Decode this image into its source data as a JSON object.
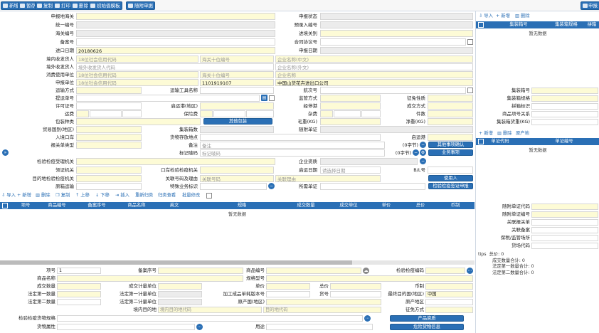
{
  "toolbar": {
    "buttons": [
      "新增",
      "暂存",
      "复制",
      "打印",
      "删除",
      "初始值模板",
      "随附单据"
    ],
    "right_button": "申报"
  },
  "form": {
    "declare_customs": "申报地海关",
    "declare_status": "申报状态",
    "unified_no": "统一编号",
    "preentry_no": "预录入编号",
    "customs_no": "海关编号",
    "entry_exit_customs": "进境关别",
    "record_no": "备案号",
    "contract_no": "合同协议号",
    "import_date": "进口日期",
    "import_date_value": "20180626",
    "declare_date": "申报日期",
    "domestic_consignee": "境内收发货人",
    "credit_code_ph": "18位社会信用代码",
    "customs_ten_ph": "海关十位编号",
    "ent_name_cn_ph": "企业名称(中文)",
    "overseas_consignee": "境外收发货人",
    "overseas_ph": "境外收发货人代码",
    "ent_name_en_ph": "企业名称(外文)",
    "consumer_unit": "消费使用单位",
    "ent_name_ph": "企业名称",
    "declare_unit": "申报单位",
    "declare_code_value": "1101919107",
    "declare_unit_name": "中国山货花卉进出口公司",
    "transport_mode": "运输方式",
    "transport_tool": "运输工具名称",
    "voyage_no": "航次号",
    "bill_no": "提运单号",
    "supervise_mode": "监管方式",
    "tax_nature": "征免性质",
    "license_no": "许可证号",
    "depart_port": "启运港(地区)",
    "bill_unit": "经停港",
    "deal_mode": "成交方式",
    "freight": "运费",
    "insurance": "保险费",
    "misc_fee": "杂费",
    "pieces": "件数",
    "pack_type": "包装种类",
    "other_pack_btn": "其他包装",
    "gross_weight": "毛重(KG)",
    "net_weight": "净重(KG)",
    "trade_country": "贸易国别(地区)",
    "container_no_q": "集装箱数",
    "attach_doc": "随附单证",
    "entry_port": "入境口岸",
    "goods_place": "货物存放地点",
    "depart_port2": "启运港",
    "declare_type": "报关单类型",
    "remark": "备注",
    "remark_ph": "备注",
    "char_count": "(0字节)",
    "other_confirm_btn": "其他事项确认",
    "mark_no": "标记唛码",
    "mark_ph": "标记唛码",
    "char_count2": "(0字节)",
    "business_btn": "业务事项",
    "inspect_org": "检验检疫受理机关",
    "ent_qual": "企业资质",
    "port_org": "领证机关",
    "port_inspect_org": "口岸检验检疫机关",
    "depart_date": "启运日期",
    "depart_date_ph": "请选择日期",
    "bl_no": "B/L号",
    "dest_org": "目的地检验检疫机关",
    "related_no": "关联号码及理由",
    "related_no_ph": "关联号码",
    "related_reason_ph": "关联理由",
    "user_btn": "使用人",
    "orig_transport": "原箱运输",
    "special_biz": "特殊业务标识",
    "attach_doc2": "所需单证",
    "inspect_cert_btn": "检验检疫签证申报"
  },
  "goods_toolbar": {
    "buttons": [
      "导入",
      "新增",
      "删除",
      "复制",
      "上移",
      "下移",
      "插入",
      "重新归类",
      "归类查看",
      "批量修改"
    ]
  },
  "goods_table": {
    "headers": [
      "项号",
      "商品编号",
      "备案序号",
      "商品名称",
      "英文",
      "规格",
      "成交数量",
      "成交单位",
      "单价",
      "总价",
      "币制"
    ],
    "empty": "暂无数据"
  },
  "detail": {
    "item_no": "项号",
    "item_no_value": "1",
    "record_seq": "备案序号",
    "goods_code": "商品编号",
    "inspect_code": "检验检疫编码",
    "goods_name": "商品名称",
    "spec": "规格型号",
    "deal_qty": "成交数量",
    "deal_unit": "成交计量单位",
    "unit_price": "单价",
    "currency": "币制",
    "legal_qty1": "法定第一数量",
    "legal_unit1": "法定第一计量单位",
    "process_ver": "加工成品单耗版本号",
    "goods_no": "货号",
    "final_dest": "最终目的国(地区)",
    "final_dest_value": "中国",
    "legal_qty2": "法定第二数量",
    "legal_unit2": "法定第二计量单位",
    "origin_country": "原产国(地区)",
    "origin_region": "原产地区",
    "domestic_dest": "境内目的地",
    "domestic_dest_ph": "境内目的地代码",
    "dest_ph": "目的地代码",
    "tax_mode": "征免方式",
    "inspect_spec": "检验检疫货物规格",
    "product_qual_btn": "产品资质",
    "goods_attr": "货物属性",
    "usage": "用途",
    "danger_goods_btn": "危险货物信息",
    "total_price": "总价"
  },
  "right": {
    "container_toolbar": [
      "导入",
      "新增",
      "删除"
    ],
    "container_headers": [
      "集装箱号",
      "集装箱规格",
      "拼箱"
    ],
    "container_empty": "暂无数据",
    "container_no": "集装箱号",
    "container_spec": "集装箱规格",
    "lcl_flag": "拼箱标识",
    "goods_seq": "商品项号关系",
    "container_weight": "集装箱货重(KG)",
    "doc_toolbar": [
      "新增",
      "删除",
      "原产地"
    ],
    "doc_headers": [
      "单证代码",
      "单证编号"
    ],
    "doc_empty": "暂无数据",
    "doc_type": "随附单证代码",
    "doc_no": "随附单证编号",
    "related_declare": "关联报关单",
    "related_record": "关联备案",
    "bonded_place": "保税/监管场所",
    "yard_code": "货场代码",
    "tips": "tips",
    "total_amount": "总价:",
    "total_amount_value": "0",
    "deal_total": "成交数量合计:",
    "deal_total_value": "0",
    "legal1_total": "法定第一数量合计:",
    "legal1_total_value": "0",
    "legal2_total": "法定第二数量合计:",
    "legal2_total_value": "0"
  }
}
